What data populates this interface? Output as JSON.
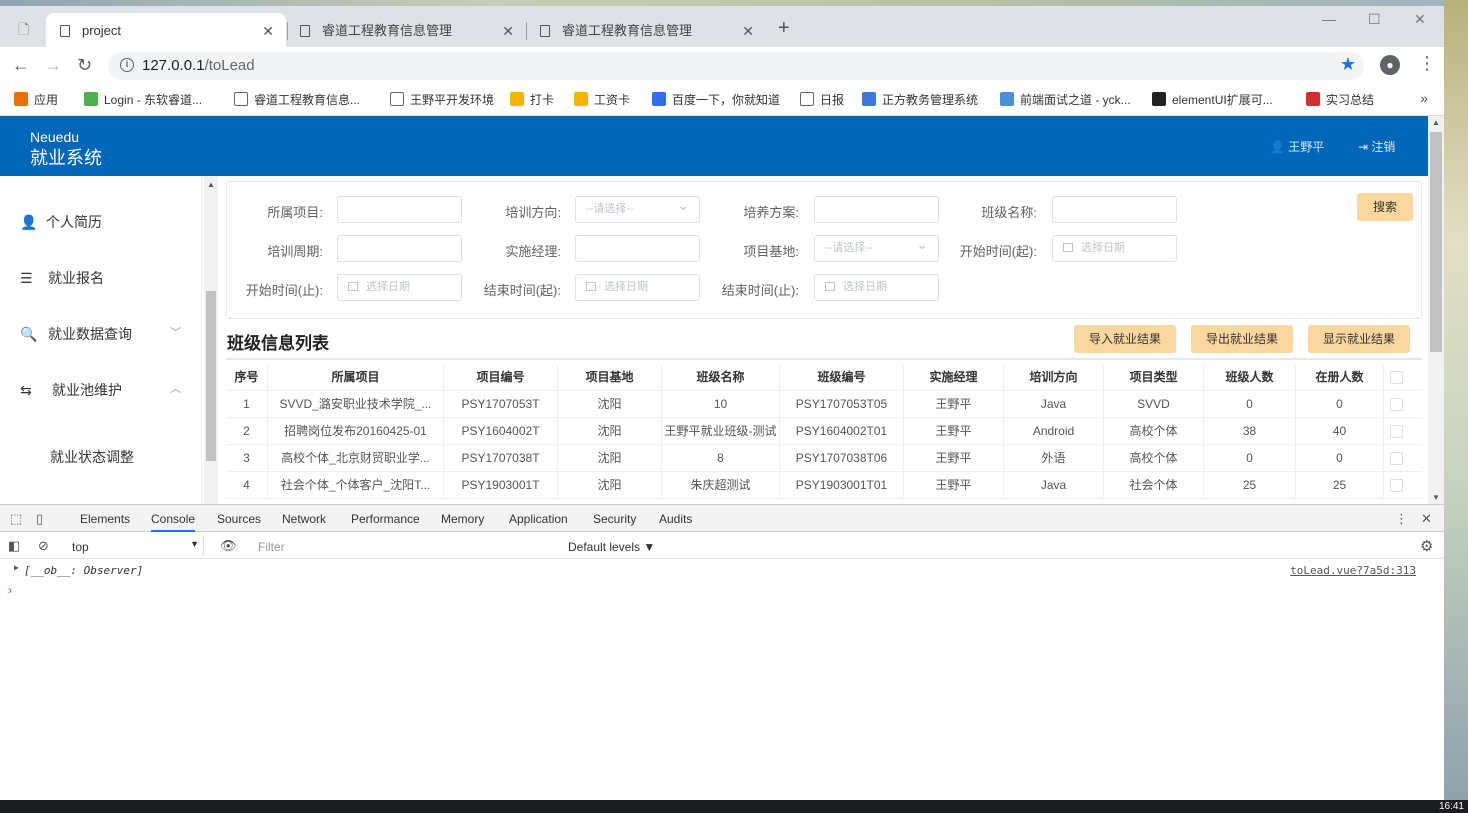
{
  "browser": {
    "tabs": [
      {
        "title": "project",
        "active": true
      },
      {
        "title": "睿道工程教育信息管理",
        "active": false
      },
      {
        "title": "睿道工程教育信息管理",
        "active": false
      }
    ],
    "new_tab": "+",
    "url_host": "127.0.0.1",
    "url_path": "/toLead",
    "bookmarks": [
      {
        "label": "应用",
        "color": "#e8710a"
      },
      {
        "label": "Login - 东软睿道...",
        "color": "#4caf50"
      },
      {
        "label": "睿道工程教育信息...",
        "color": "#ffffff"
      },
      {
        "label": "王野平开发环境",
        "color": "#ffffff"
      },
      {
        "label": "打卡",
        "color": "#f5b400"
      },
      {
        "label": "工资卡",
        "color": "#f5b400"
      },
      {
        "label": "百度一下，你就知道",
        "color": "#2f6ee6"
      },
      {
        "label": "日报",
        "color": "#ffffff"
      },
      {
        "label": "正方教务管理系统",
        "color": "#3b78d8"
      },
      {
        "label": "前端面试之道 - yck...",
        "color": "#4a90d9"
      },
      {
        "label": "elementUI扩展可...",
        "color": "#222222"
      },
      {
        "label": "实习总结",
        "color": "#d32f2f"
      }
    ],
    "bookmarks_more": "»"
  },
  "app": {
    "brand_en": "Neuedu",
    "brand_cn": "就业系统",
    "user": "王野平",
    "logout": "注销",
    "user_icon": "user-icon",
    "logout_icon": "logout-icon"
  },
  "sidebar": {
    "items": [
      {
        "label": "个人简历",
        "icon": "person-icon",
        "glyph": "👤"
      },
      {
        "label": "就业报名",
        "icon": "list-icon",
        "glyph": "☰"
      },
      {
        "label": "就业数据查询",
        "icon": "search-icon",
        "glyph": "🔍",
        "arrow": "﹀"
      },
      {
        "label": "就业池维护",
        "icon": "swap-icon",
        "glyph": "⇆",
        "arrow": "︿"
      },
      {
        "label": "就业状态调整",
        "icon": "",
        "glyph": ""
      }
    ]
  },
  "filter": {
    "labels": [
      "所属项目:",
      "培训方向:",
      "培养方案:",
      "班级名称:",
      "培训周期:",
      "实施经理:",
      "项目基地:",
      "开始时间(起):",
      "开始时间(止):",
      "结束时间(起):",
      "结束时间(止):"
    ],
    "select_placeholder": "--请选择--",
    "date_placeholder": "选择日期",
    "search_button": "搜索"
  },
  "list": {
    "title": "班级信息列表",
    "import_button": "导入就业结果",
    "export_button": "导出就业结果",
    "show_button": "显示就业结果",
    "columns": [
      "序号",
      "所属项目",
      "项目编号",
      "项目基地",
      "班级名称",
      "班级编号",
      "实施经理",
      "培训方向",
      "项目类型",
      "班级人数",
      "在册人数"
    ],
    "rows": [
      [
        "1",
        "SVVD_潞安职业技术学院_...",
        "PSY1707053T",
        "沈阳",
        "10",
        "PSY1707053T05",
        "王野平",
        "Java",
        "SVVD",
        "0",
        "0"
      ],
      [
        "2",
        "招聘岗位发布20160425-01",
        "PSY1604002T",
        "沈阳",
        "王野平就业班级-测试",
        "PSY1604002T01",
        "王野平",
        "Android",
        "高校个体",
        "38",
        "40"
      ],
      [
        "3",
        "高校个体_北京财贸职业学...",
        "PSY1707038T",
        "沈阳",
        "8",
        "PSY1707038T06",
        "王野平",
        "外语",
        "高校个体",
        "0",
        "0"
      ],
      [
        "4",
        "社会个体_个体客户_沈阳T...",
        "PSY1903001T",
        "沈阳",
        "朱庆超测试",
        "PSY1903001T01",
        "王野平",
        "Java",
        "社会个体",
        "25",
        "25"
      ]
    ]
  },
  "devtools": {
    "tabs": [
      "Elements",
      "Console",
      "Sources",
      "Network",
      "Performance",
      "Memory",
      "Application",
      "Security",
      "Audits"
    ],
    "active_tab": "Console",
    "context": "top",
    "filter_placeholder": "Filter",
    "levels": "Default levels ▼",
    "log_message": "[__ob__: Observer]",
    "log_source": "toLead.vue?7a5d:313",
    "prompt": "›"
  },
  "taskbar": {
    "clock": "16:41"
  }
}
